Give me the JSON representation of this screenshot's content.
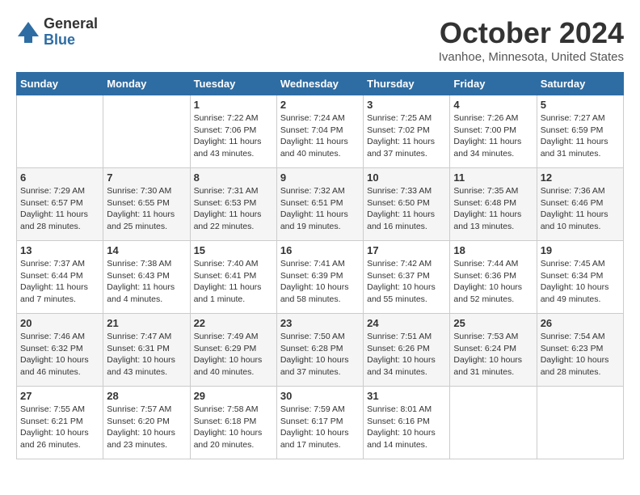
{
  "logo": {
    "general": "General",
    "blue": "Blue"
  },
  "title": "October 2024",
  "location": "Ivanhoe, Minnesota, United States",
  "weekdays": [
    "Sunday",
    "Monday",
    "Tuesday",
    "Wednesday",
    "Thursday",
    "Friday",
    "Saturday"
  ],
  "weeks": [
    [
      {
        "day": "",
        "info": ""
      },
      {
        "day": "",
        "info": ""
      },
      {
        "day": "1",
        "info": "Sunrise: 7:22 AM\nSunset: 7:06 PM\nDaylight: 11 hours and 43 minutes."
      },
      {
        "day": "2",
        "info": "Sunrise: 7:24 AM\nSunset: 7:04 PM\nDaylight: 11 hours and 40 minutes."
      },
      {
        "day": "3",
        "info": "Sunrise: 7:25 AM\nSunset: 7:02 PM\nDaylight: 11 hours and 37 minutes."
      },
      {
        "day": "4",
        "info": "Sunrise: 7:26 AM\nSunset: 7:00 PM\nDaylight: 11 hours and 34 minutes."
      },
      {
        "day": "5",
        "info": "Sunrise: 7:27 AM\nSunset: 6:59 PM\nDaylight: 11 hours and 31 minutes."
      }
    ],
    [
      {
        "day": "6",
        "info": "Sunrise: 7:29 AM\nSunset: 6:57 PM\nDaylight: 11 hours and 28 minutes."
      },
      {
        "day": "7",
        "info": "Sunrise: 7:30 AM\nSunset: 6:55 PM\nDaylight: 11 hours and 25 minutes."
      },
      {
        "day": "8",
        "info": "Sunrise: 7:31 AM\nSunset: 6:53 PM\nDaylight: 11 hours and 22 minutes."
      },
      {
        "day": "9",
        "info": "Sunrise: 7:32 AM\nSunset: 6:51 PM\nDaylight: 11 hours and 19 minutes."
      },
      {
        "day": "10",
        "info": "Sunrise: 7:33 AM\nSunset: 6:50 PM\nDaylight: 11 hours and 16 minutes."
      },
      {
        "day": "11",
        "info": "Sunrise: 7:35 AM\nSunset: 6:48 PM\nDaylight: 11 hours and 13 minutes."
      },
      {
        "day": "12",
        "info": "Sunrise: 7:36 AM\nSunset: 6:46 PM\nDaylight: 11 hours and 10 minutes."
      }
    ],
    [
      {
        "day": "13",
        "info": "Sunrise: 7:37 AM\nSunset: 6:44 PM\nDaylight: 11 hours and 7 minutes."
      },
      {
        "day": "14",
        "info": "Sunrise: 7:38 AM\nSunset: 6:43 PM\nDaylight: 11 hours and 4 minutes."
      },
      {
        "day": "15",
        "info": "Sunrise: 7:40 AM\nSunset: 6:41 PM\nDaylight: 11 hours and 1 minute."
      },
      {
        "day": "16",
        "info": "Sunrise: 7:41 AM\nSunset: 6:39 PM\nDaylight: 10 hours and 58 minutes."
      },
      {
        "day": "17",
        "info": "Sunrise: 7:42 AM\nSunset: 6:37 PM\nDaylight: 10 hours and 55 minutes."
      },
      {
        "day": "18",
        "info": "Sunrise: 7:44 AM\nSunset: 6:36 PM\nDaylight: 10 hours and 52 minutes."
      },
      {
        "day": "19",
        "info": "Sunrise: 7:45 AM\nSunset: 6:34 PM\nDaylight: 10 hours and 49 minutes."
      }
    ],
    [
      {
        "day": "20",
        "info": "Sunrise: 7:46 AM\nSunset: 6:32 PM\nDaylight: 10 hours and 46 minutes."
      },
      {
        "day": "21",
        "info": "Sunrise: 7:47 AM\nSunset: 6:31 PM\nDaylight: 10 hours and 43 minutes."
      },
      {
        "day": "22",
        "info": "Sunrise: 7:49 AM\nSunset: 6:29 PM\nDaylight: 10 hours and 40 minutes."
      },
      {
        "day": "23",
        "info": "Sunrise: 7:50 AM\nSunset: 6:28 PM\nDaylight: 10 hours and 37 minutes."
      },
      {
        "day": "24",
        "info": "Sunrise: 7:51 AM\nSunset: 6:26 PM\nDaylight: 10 hours and 34 minutes."
      },
      {
        "day": "25",
        "info": "Sunrise: 7:53 AM\nSunset: 6:24 PM\nDaylight: 10 hours and 31 minutes."
      },
      {
        "day": "26",
        "info": "Sunrise: 7:54 AM\nSunset: 6:23 PM\nDaylight: 10 hours and 28 minutes."
      }
    ],
    [
      {
        "day": "27",
        "info": "Sunrise: 7:55 AM\nSunset: 6:21 PM\nDaylight: 10 hours and 26 minutes."
      },
      {
        "day": "28",
        "info": "Sunrise: 7:57 AM\nSunset: 6:20 PM\nDaylight: 10 hours and 23 minutes."
      },
      {
        "day": "29",
        "info": "Sunrise: 7:58 AM\nSunset: 6:18 PM\nDaylight: 10 hours and 20 minutes."
      },
      {
        "day": "30",
        "info": "Sunrise: 7:59 AM\nSunset: 6:17 PM\nDaylight: 10 hours and 17 minutes."
      },
      {
        "day": "31",
        "info": "Sunrise: 8:01 AM\nSunset: 6:16 PM\nDaylight: 10 hours and 14 minutes."
      },
      {
        "day": "",
        "info": ""
      },
      {
        "day": "",
        "info": ""
      }
    ]
  ]
}
